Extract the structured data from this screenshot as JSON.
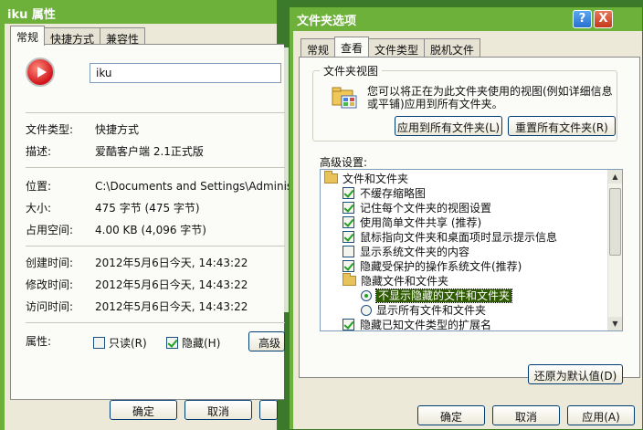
{
  "left_window": {
    "title": "iku 属性",
    "tabs": [
      "常规",
      "快捷方式",
      "兼容性"
    ],
    "name_value": "iku",
    "file_type_label": "文件类型:",
    "file_type_value": "快捷方式",
    "desc_label": "描述:",
    "desc_value": "爱酷客户端 2.1正式版",
    "location_label": "位置:",
    "location_value": "C:\\Documents and Settings\\Administra",
    "size_label": "大小:",
    "size_value": "475 字节 (475 字节)",
    "size_on_disk_label": "占用空间:",
    "size_on_disk_value": "4.00 KB (4,096 字节)",
    "created_label": "创建时间:",
    "created_value": "2012年5月6日今天, 14:43:22",
    "modified_label": "修改时间:",
    "modified_value": "2012年5月6日今天, 14:43:22",
    "accessed_label": "访问时间:",
    "accessed_value": "2012年5月6日今天, 14:43:22",
    "attributes_label": "属性:",
    "readonly_label": "只读(R)",
    "hidden_label": "隐藏(H)",
    "advanced_label": "高级",
    "ok_label": "确定",
    "cancel_label": "取消"
  },
  "right_window": {
    "title": "文件夹选项",
    "help_glyph": "?",
    "close_glyph": "X",
    "tabs": [
      "常规",
      "查看",
      "文件类型",
      "脱机文件"
    ],
    "folder_view_title": "文件夹视图",
    "folder_view_desc": "您可以将正在为此文件夹使用的视图(例如详细信息或平铺)应用到所有文件夹。",
    "apply_all_label": "应用到所有文件夹(L)",
    "reset_all_label": "重置所有文件夹(R)",
    "advanced_label": "高级设置:",
    "items": [
      "文件和文件夹",
      "不缓存缩略图",
      "记住每个文件夹的视图设置",
      "使用简单文件共享 (推荐)",
      "鼠标指向文件夹和桌面项时显示提示信息",
      "显示系统文件夹的内容",
      "隐藏受保护的操作系统文件(推荐)",
      "隐藏文件和文件夹",
      "不显示隐藏的文件和文件夹",
      "显示所有文件和文件夹",
      "隐藏已知文件类型的扩展名"
    ],
    "restore_defaults_label": "还原为默认值(D)",
    "ok_label": "确定",
    "cancel_label": "取消",
    "apply_label": "应用(A)"
  }
}
